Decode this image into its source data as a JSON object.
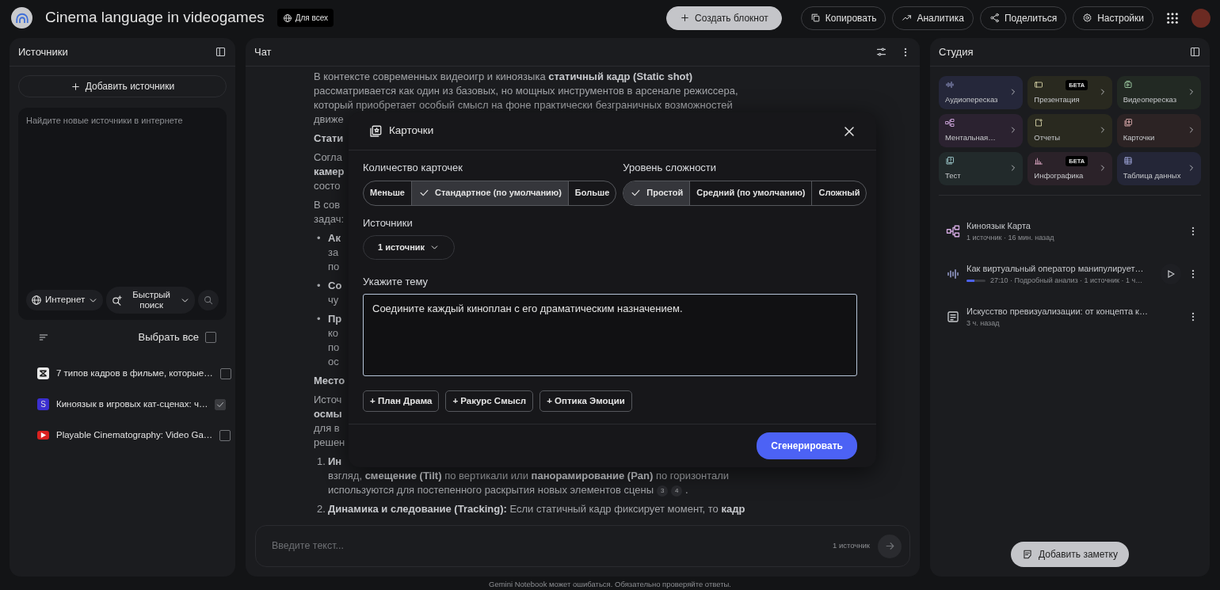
{
  "header": {
    "title": "Cinema language in videogames",
    "visibility": "Для всех",
    "actions": [
      {
        "kind": "create",
        "label": "Создать блокнот"
      },
      {
        "kind": "copy",
        "label": "Копировать"
      },
      {
        "kind": "analytics",
        "label": "Аналитика"
      },
      {
        "kind": "share",
        "label": "Поделиться"
      },
      {
        "kind": "settings",
        "label": "Настройки"
      }
    ]
  },
  "sources": {
    "title": "Источники",
    "add_button": "Добавить источники",
    "search": {
      "placeholder": "Найдите новые источники в интернете",
      "source_dropdown": "Интернет",
      "mode_dropdown": "Быстрый поиск"
    },
    "select_all": {
      "label": "Выбрать все",
      "checked": false
    },
    "items": [
      {
        "kind": "app",
        "title": "7 типов кадров в фильме, которые…",
        "checked": false
      },
      {
        "kind": "letter",
        "letter": "S",
        "title": "Киноязык в игровых кат-сценах: ч…",
        "checked": true
      },
      {
        "kind": "video",
        "title": "Playable Cinematography: Video Ga…",
        "checked": false
      }
    ]
  },
  "chat": {
    "title": "Чат",
    "blocks": [
      {
        "kind": "paragraph",
        "lines": [
          "В контексте современных видеоигр и киноязыка **статичный кадр (Static shot)**",
          "рассматривается как один из базовых, но мощных инструментов в арсенале режиссера,",
          "который приобретает особый смысл на фоне практически безграничных возможностей",
          "движе"
        ]
      },
      {
        "kind": "heading",
        "lines": [
          "Стати"
        ]
      },
      {
        "kind": "paragraph",
        "lines": [
          "Согла",
          "**камер**",
          "состо"
        ]
      },
      {
        "kind": "paragraph",
        "lines": [
          "В сов",
          "задач:"
        ]
      },
      {
        "kind": "bullet",
        "marker": "•",
        "lines": [
          "**Ак**",
          "за",
          "по"
        ]
      },
      {
        "kind": "bullet",
        "marker": "•",
        "lines": [
          "**Со**",
          "чу"
        ]
      },
      {
        "kind": "bullet",
        "marker": "•",
        "lines": [
          "**Пр**",
          "ко",
          "по",
          "ос"
        ]
      },
      {
        "kind": "heading",
        "lines": [
          "Место"
        ]
      },
      {
        "kind": "paragraph",
        "lines": [
          "Источ",
          "**осмы**",
          "для в",
          "решен"
        ]
      },
      {
        "kind": "numbered",
        "marker": "1.",
        "lines": [
          "**Ин**",
          "взгляд, **смещение (Tilt)** по вертикали или **панорамирование (Pan)** по горизонтали",
          "используются для постепенного раскрытия новых элементов сцены"
        ],
        "citations": [
          "3",
          "4"
        ],
        "tail": "."
      },
      {
        "kind": "numbered",
        "marker": "2.",
        "lines": [
          "**Динамика и следование (Tracking):** Если статичный кадр фиксирует момент, то **кадр**"
        ]
      }
    ],
    "input": {
      "placeholder": "Введите текст...",
      "source_count": "1 источник"
    }
  },
  "studio": {
    "title": "Студия",
    "tools": [
      {
        "kind": "audio",
        "label": "Аудиопересказ",
        "color": "#25273a"
      },
      {
        "kind": "slides",
        "label": "Презентация",
        "badge": "БЕТА",
        "color": "#29291f"
      },
      {
        "kind": "video",
        "label": "Видеопересказ",
        "color": "#222923"
      },
      {
        "kind": "mindmap",
        "label": "Ментальная…",
        "color": "#2b2230"
      },
      {
        "kind": "report",
        "label": "Отчеты",
        "color": "#29291f"
      },
      {
        "kind": "cards",
        "label": "Карточки",
        "color": "#2c2324"
      },
      {
        "kind": "quiz",
        "label": "Тест",
        "color": "#222a2b"
      },
      {
        "kind": "infographic",
        "label": "Инфографика",
        "badge": "БЕТА",
        "color": "#2b2229"
      },
      {
        "kind": "table",
        "label": "Таблица данных",
        "color": "#242637"
      }
    ],
    "notes": [
      {
        "kind": "mindmap",
        "title": "Киноязык Карта",
        "meta": "1 источник · 16 мин. назад"
      },
      {
        "kind": "audio",
        "title": "Как виртуальный оператор манипулирует…",
        "meta": "27:10 · Подробный анализ · 1 источник · 1 ч…",
        "level": 0.4
      },
      {
        "kind": "note",
        "title": "Искусство превизуализации: от концепта к…",
        "meta": "3 ч. назад"
      }
    ],
    "add_note": "Добавить заметку"
  },
  "dialog": {
    "title": "Карточки",
    "count": {
      "label": "Количество карточек",
      "options": [
        {
          "label": "Меньше",
          "selected": false
        },
        {
          "label": "Стандартное (по умолчанию)",
          "selected": true
        },
        {
          "label": "Больше",
          "selected": false
        }
      ]
    },
    "difficulty": {
      "label": "Уровень сложности",
      "options": [
        {
          "label": "Простой",
          "selected": true
        },
        {
          "label": "Средний (по умолчанию)",
          "selected": false
        },
        {
          "label": "Сложный",
          "selected": false
        }
      ]
    },
    "sources": {
      "label": "Источники",
      "value": "1 источник"
    },
    "topic": {
      "label": "Укажите тему",
      "value": "Соедините каждый киноплан с его драматическим назначением."
    },
    "suggestions": [
      "+ План Драма",
      "+ Ракурс Смысл",
      "+ Оптика Эмоции"
    ],
    "generate": "Сгенерировать"
  },
  "footer": "Gemini Notebook может ошибаться. Обязательно проверяйте ответы."
}
